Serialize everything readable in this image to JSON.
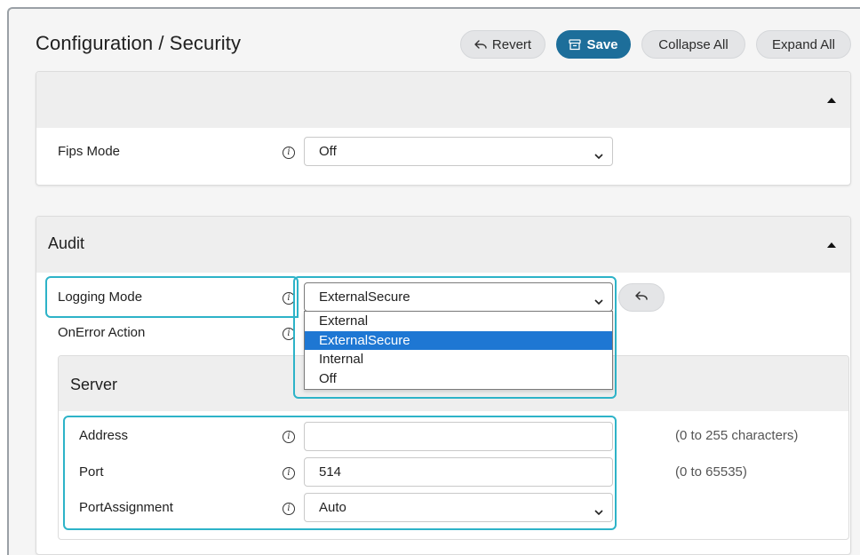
{
  "header": {
    "title": "Configuration / Security",
    "revert_label": "Revert",
    "save_label": "Save",
    "collapse_label": "Collapse All",
    "expand_label": "Expand All"
  },
  "fips_section": {
    "label": "Fips Mode",
    "value": "Off"
  },
  "audit_section": {
    "title": "Audit",
    "logging_mode": {
      "label": "Logging Mode",
      "value": "ExternalSecure",
      "options": [
        "External",
        "ExternalSecure",
        "Internal",
        "Off"
      ],
      "selected_index": 1
    },
    "onerror_label": "OnError Action"
  },
  "server_section": {
    "title": "Server",
    "address": {
      "label": "Address",
      "value": "",
      "hint": "(0 to 255 characters)"
    },
    "port": {
      "label": "Port",
      "value": "514",
      "hint": "(0 to 65535)"
    },
    "port_assignment": {
      "label": "PortAssignment",
      "value": "Auto"
    }
  },
  "colors": {
    "save_button": "#1d6e9a",
    "focus_outline": "#2db3c8",
    "selected_option": "#1e77d3"
  },
  "icons": {
    "revert": "undo-arrow-icon",
    "save": "archive-box-icon",
    "info": "info-icon",
    "collapse": "caret-up-icon",
    "select": "chevron-down-icon"
  }
}
